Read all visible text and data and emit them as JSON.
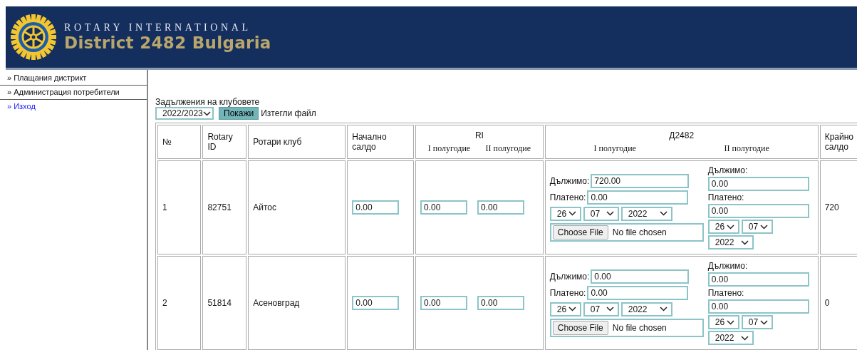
{
  "header": {
    "tagline": "ROTARY INTERNATIONAL",
    "title": "District 2482 Bulgaria"
  },
  "sidebar": {
    "items": [
      {
        "label": "» Плащания дистрикт",
        "kind": "item"
      },
      {
        "label": "» Администрация потребители",
        "kind": "item"
      },
      {
        "label": "» Изход",
        "kind": "link"
      }
    ]
  },
  "report": {
    "title": "Задължения на клубовете",
    "year_select": "2022/2023",
    "show_button": "Покажи",
    "download_link": "Изтегли файл"
  },
  "table": {
    "columns": [
      {
        "label": "№"
      },
      {
        "label": "Rotary ID"
      },
      {
        "label": "Ротари клуб"
      },
      {
        "label": "Начално салдо"
      },
      {
        "label": "RI",
        "sub": [
          "I полугодие",
          "II полугодие"
        ]
      },
      {
        "label": "Д2482",
        "sub": [
          "I полугодие",
          "II полугодие"
        ]
      },
      {
        "label": "Крайно салдо"
      }
    ],
    "rows": [
      {
        "no": "1",
        "rotary_id": "82751",
        "club": "Айтос",
        "opening": "0.00",
        "ri_h1": "0.00",
        "ri_h2": "0.00",
        "d_h1": {
          "owed_label": "Дължимо:",
          "owed": "720.00",
          "paid_label": "Платено:",
          "paid": "0.00",
          "day": "26",
          "month": "07",
          "year": "2022",
          "file_button": "Choose File",
          "file_status": "No file chosen"
        },
        "d_h2": {
          "owed_label": "Дължимо:",
          "owed": "0.00",
          "paid_label": "Платено:",
          "paid": "0.00",
          "day": "26",
          "month": "07",
          "year": "2022"
        },
        "closing": "720"
      },
      {
        "no": "2",
        "rotary_id": "51814",
        "club": "Асеновград",
        "opening": "0.00",
        "ri_h1": "0.00",
        "ri_h2": "0.00",
        "d_h1": {
          "owed_label": "Дължимо:",
          "owed": "0.00",
          "paid_label": "Платено:",
          "paid": "0.00",
          "day": "26",
          "month": "07",
          "year": "2022",
          "file_button": "Choose File",
          "file_status": "No file chosen"
        },
        "d_h2": {
          "owed_label": "Дължимо:",
          "owed": "0.00",
          "paid_label": "Платено:",
          "paid": "0.00",
          "day": "26",
          "month": "07",
          "year": "2022"
        },
        "closing": "0"
      }
    ]
  }
}
